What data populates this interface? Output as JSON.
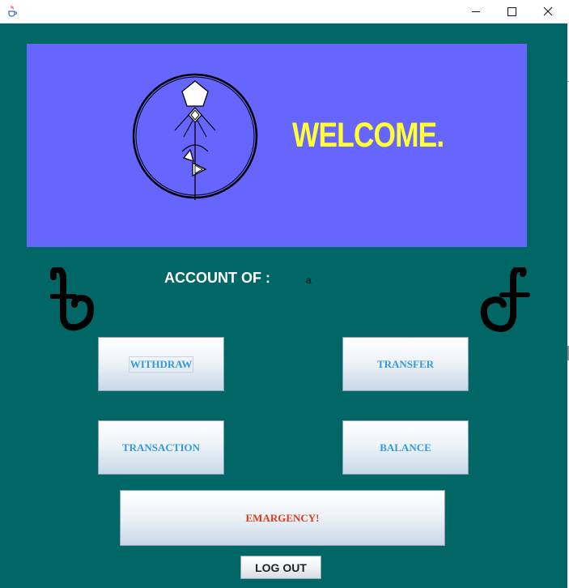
{
  "window": {
    "title": "",
    "controls": {
      "minimize_icon": "minimize-icon",
      "maximize_icon": "maximize-icon",
      "close_icon": "close-icon"
    },
    "app_icon": "java-cup-icon"
  },
  "banner": {
    "logo_icon": "stick-figure-emblem-icon",
    "welcome_text": "WELCOME.",
    "background_color": "#6666ff",
    "text_color": "#ffff33"
  },
  "account": {
    "label": "ACCOUNT OF :",
    "value": "a"
  },
  "currency_icons": {
    "left": "taka-sign-icon",
    "right": "taka-sign-icon"
  },
  "buttons": {
    "withdraw": "WITHDRAW",
    "transfer": "TRANSFER",
    "transaction": "TRANSACTION",
    "balance": "BALANCE",
    "emergency": "EMARGENCY!",
    "logout": "LOG OUT"
  },
  "colors": {
    "content_background": "#006666",
    "button_text": "#3399dd",
    "emergency_text": "#e03a1a"
  }
}
